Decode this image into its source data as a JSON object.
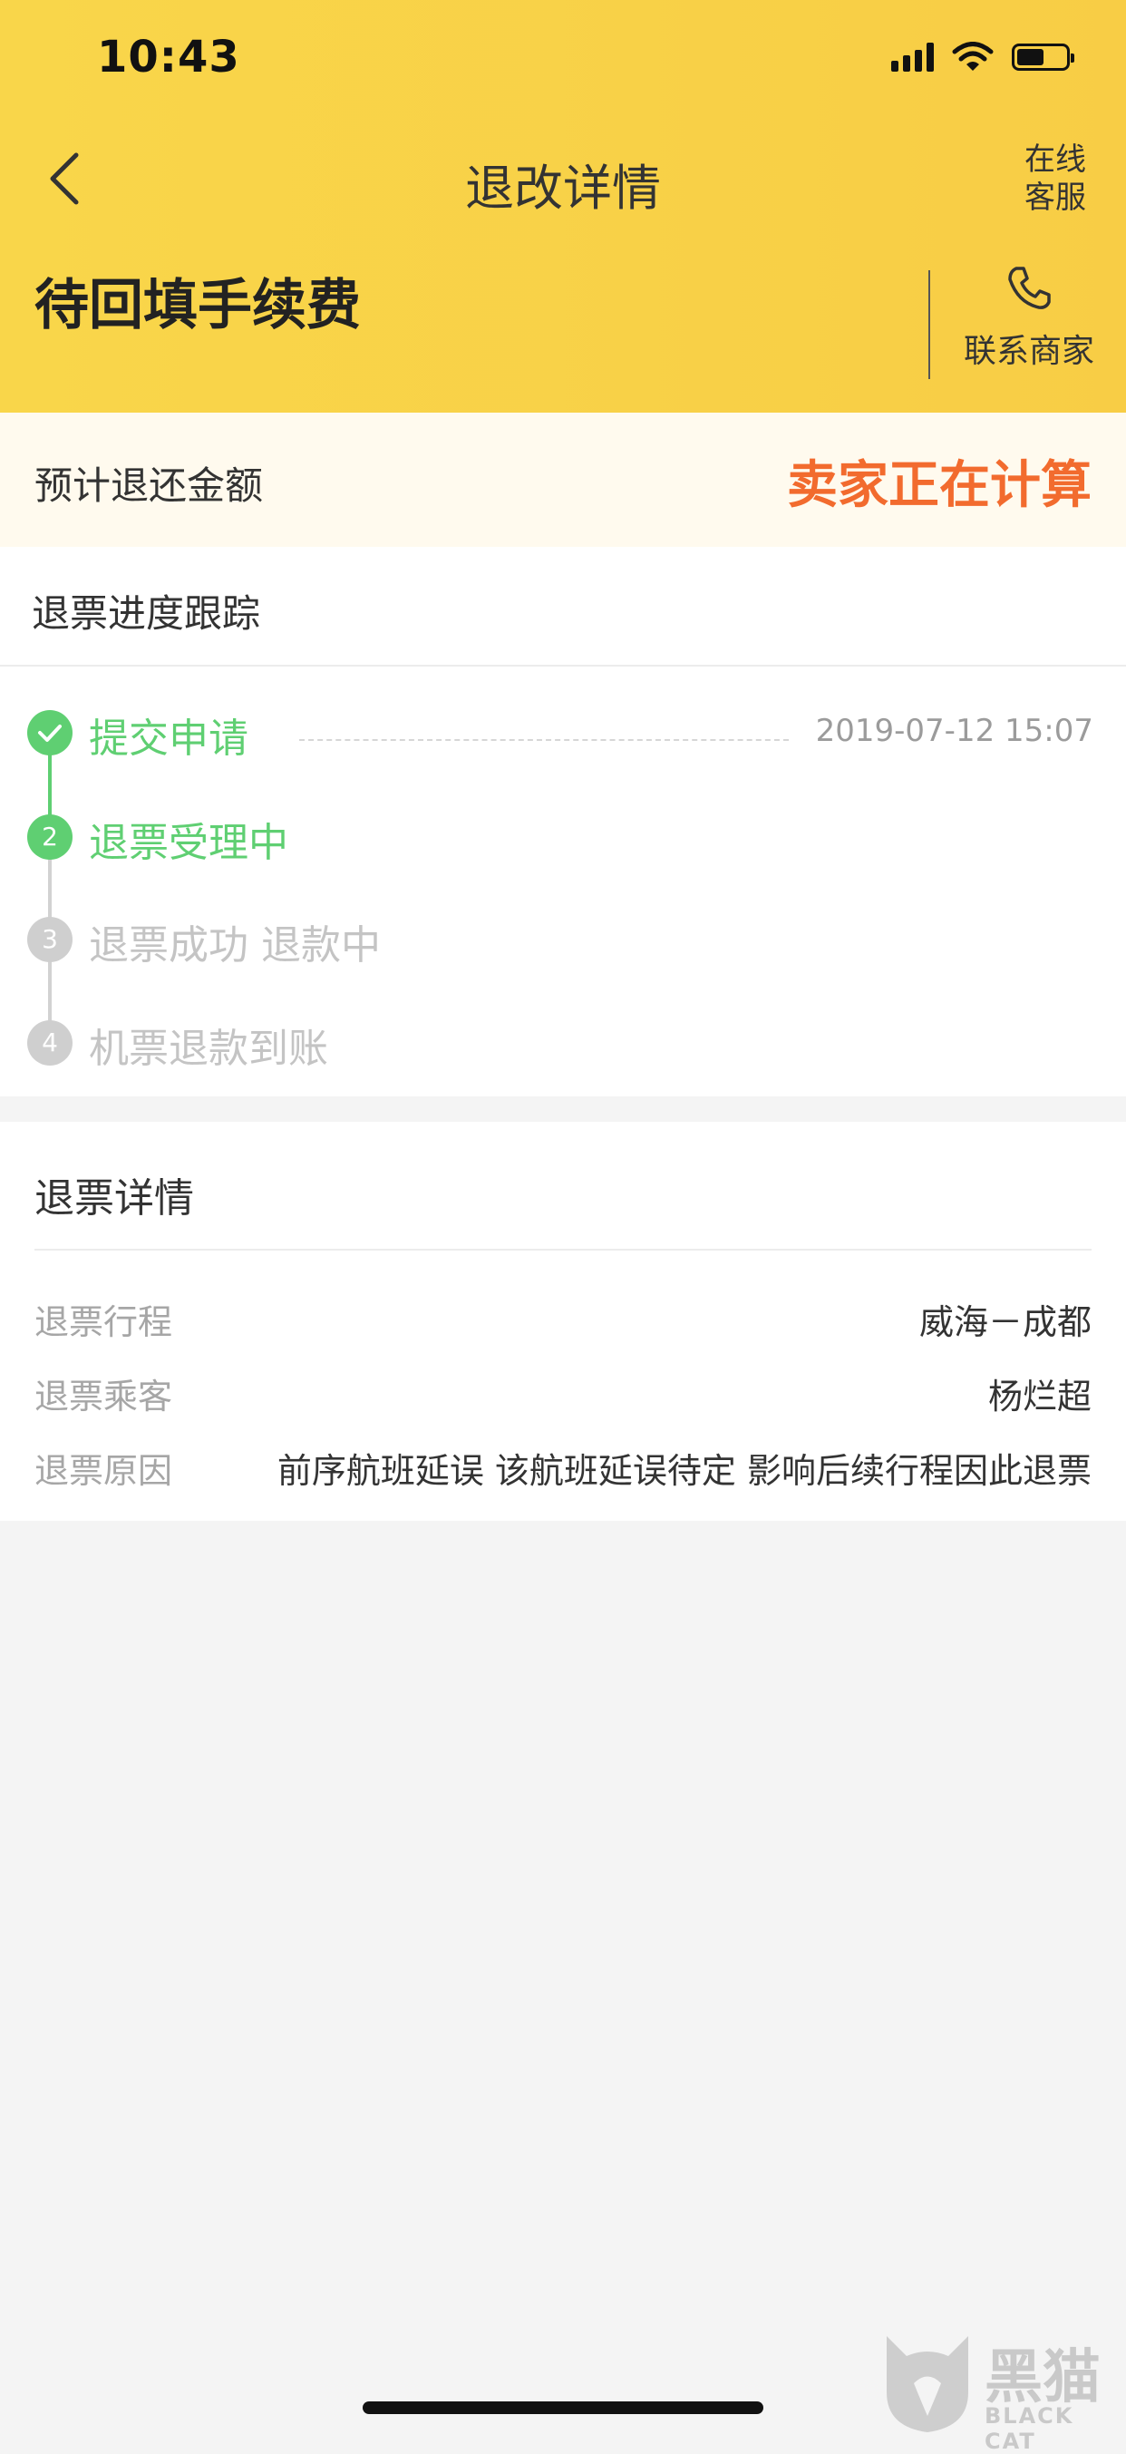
{
  "status_bar": {
    "time": "10:43",
    "battery_level": 0.55
  },
  "nav": {
    "title": "退改详情",
    "service_label": "在线客服"
  },
  "order": {
    "status": "待回填手续费",
    "contact_label": "联系商家"
  },
  "estimate": {
    "label": "预计退还金额",
    "value": "卖家正在计算"
  },
  "progress": {
    "title": "退票进度跟踪",
    "steps": [
      {
        "marker": "",
        "label": "提交申请",
        "time": "2019-07-12 15:07",
        "state": "done"
      },
      {
        "marker": "2",
        "label": "退票受理中",
        "state": "done"
      },
      {
        "marker": "3",
        "label": "退票成功 退款中",
        "state": "todo"
      },
      {
        "marker": "4",
        "label": "机票退款到账",
        "state": "todo"
      }
    ]
  },
  "detail": {
    "title": "退票详情",
    "rows": [
      {
        "label": "退票行程",
        "value": "威海－成都"
      },
      {
        "label": "退票乘客",
        "value": "杨烂超"
      },
      {
        "label": "退票原因",
        "value": "前序航班延误 该航班延误待定 影响后续行程因此退票"
      }
    ]
  },
  "watermark": {
    "cn": "黑猫",
    "en": "BLACK CAT"
  },
  "colors": {
    "header_yellow": "#f9d64a",
    "accent_orange": "#f26b2e",
    "done_green": "#5fcf72",
    "todo_gray": "#cfcfcf"
  }
}
